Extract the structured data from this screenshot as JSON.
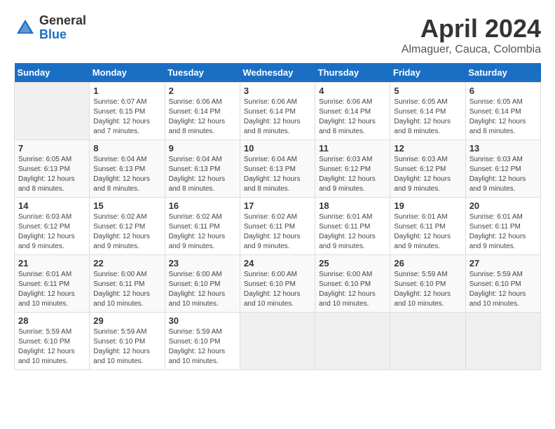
{
  "logo": {
    "general": "General",
    "blue": "Blue"
  },
  "title": {
    "month_year": "April 2024",
    "location": "Almaguer, Cauca, Colombia"
  },
  "days_of_week": [
    "Sunday",
    "Monday",
    "Tuesday",
    "Wednesday",
    "Thursday",
    "Friday",
    "Saturday"
  ],
  "weeks": [
    [
      {
        "day": "",
        "sunrise": "",
        "sunset": "",
        "daylight": ""
      },
      {
        "day": "1",
        "sunrise": "Sunrise: 6:07 AM",
        "sunset": "Sunset: 6:15 PM",
        "daylight": "Daylight: 12 hours and 7 minutes."
      },
      {
        "day": "2",
        "sunrise": "Sunrise: 6:06 AM",
        "sunset": "Sunset: 6:14 PM",
        "daylight": "Daylight: 12 hours and 8 minutes."
      },
      {
        "day": "3",
        "sunrise": "Sunrise: 6:06 AM",
        "sunset": "Sunset: 6:14 PM",
        "daylight": "Daylight: 12 hours and 8 minutes."
      },
      {
        "day": "4",
        "sunrise": "Sunrise: 6:06 AM",
        "sunset": "Sunset: 6:14 PM",
        "daylight": "Daylight: 12 hours and 8 minutes."
      },
      {
        "day": "5",
        "sunrise": "Sunrise: 6:05 AM",
        "sunset": "Sunset: 6:14 PM",
        "daylight": "Daylight: 12 hours and 8 minutes."
      },
      {
        "day": "6",
        "sunrise": "Sunrise: 6:05 AM",
        "sunset": "Sunset: 6:14 PM",
        "daylight": "Daylight: 12 hours and 8 minutes."
      }
    ],
    [
      {
        "day": "7",
        "sunrise": "Sunrise: 6:05 AM",
        "sunset": "Sunset: 6:13 PM",
        "daylight": "Daylight: 12 hours and 8 minutes."
      },
      {
        "day": "8",
        "sunrise": "Sunrise: 6:04 AM",
        "sunset": "Sunset: 6:13 PM",
        "daylight": "Daylight: 12 hours and 8 minutes."
      },
      {
        "day": "9",
        "sunrise": "Sunrise: 6:04 AM",
        "sunset": "Sunset: 6:13 PM",
        "daylight": "Daylight: 12 hours and 8 minutes."
      },
      {
        "day": "10",
        "sunrise": "Sunrise: 6:04 AM",
        "sunset": "Sunset: 6:13 PM",
        "daylight": "Daylight: 12 hours and 8 minutes."
      },
      {
        "day": "11",
        "sunrise": "Sunrise: 6:03 AM",
        "sunset": "Sunset: 6:12 PM",
        "daylight": "Daylight: 12 hours and 9 minutes."
      },
      {
        "day": "12",
        "sunrise": "Sunrise: 6:03 AM",
        "sunset": "Sunset: 6:12 PM",
        "daylight": "Daylight: 12 hours and 9 minutes."
      },
      {
        "day": "13",
        "sunrise": "Sunrise: 6:03 AM",
        "sunset": "Sunset: 6:12 PM",
        "daylight": "Daylight: 12 hours and 9 minutes."
      }
    ],
    [
      {
        "day": "14",
        "sunrise": "Sunrise: 6:03 AM",
        "sunset": "Sunset: 6:12 PM",
        "daylight": "Daylight: 12 hours and 9 minutes."
      },
      {
        "day": "15",
        "sunrise": "Sunrise: 6:02 AM",
        "sunset": "Sunset: 6:12 PM",
        "daylight": "Daylight: 12 hours and 9 minutes."
      },
      {
        "day": "16",
        "sunrise": "Sunrise: 6:02 AM",
        "sunset": "Sunset: 6:11 PM",
        "daylight": "Daylight: 12 hours and 9 minutes."
      },
      {
        "day": "17",
        "sunrise": "Sunrise: 6:02 AM",
        "sunset": "Sunset: 6:11 PM",
        "daylight": "Daylight: 12 hours and 9 minutes."
      },
      {
        "day": "18",
        "sunrise": "Sunrise: 6:01 AM",
        "sunset": "Sunset: 6:11 PM",
        "daylight": "Daylight: 12 hours and 9 minutes."
      },
      {
        "day": "19",
        "sunrise": "Sunrise: 6:01 AM",
        "sunset": "Sunset: 6:11 PM",
        "daylight": "Daylight: 12 hours and 9 minutes."
      },
      {
        "day": "20",
        "sunrise": "Sunrise: 6:01 AM",
        "sunset": "Sunset: 6:11 PM",
        "daylight": "Daylight: 12 hours and 9 minutes."
      }
    ],
    [
      {
        "day": "21",
        "sunrise": "Sunrise: 6:01 AM",
        "sunset": "Sunset: 6:11 PM",
        "daylight": "Daylight: 12 hours and 10 minutes."
      },
      {
        "day": "22",
        "sunrise": "Sunrise: 6:00 AM",
        "sunset": "Sunset: 6:11 PM",
        "daylight": "Daylight: 12 hours and 10 minutes."
      },
      {
        "day": "23",
        "sunrise": "Sunrise: 6:00 AM",
        "sunset": "Sunset: 6:10 PM",
        "daylight": "Daylight: 12 hours and 10 minutes."
      },
      {
        "day": "24",
        "sunrise": "Sunrise: 6:00 AM",
        "sunset": "Sunset: 6:10 PM",
        "daylight": "Daylight: 12 hours and 10 minutes."
      },
      {
        "day": "25",
        "sunrise": "Sunrise: 6:00 AM",
        "sunset": "Sunset: 6:10 PM",
        "daylight": "Daylight: 12 hours and 10 minutes."
      },
      {
        "day": "26",
        "sunrise": "Sunrise: 5:59 AM",
        "sunset": "Sunset: 6:10 PM",
        "daylight": "Daylight: 12 hours and 10 minutes."
      },
      {
        "day": "27",
        "sunrise": "Sunrise: 5:59 AM",
        "sunset": "Sunset: 6:10 PM",
        "daylight": "Daylight: 12 hours and 10 minutes."
      }
    ],
    [
      {
        "day": "28",
        "sunrise": "Sunrise: 5:59 AM",
        "sunset": "Sunset: 6:10 PM",
        "daylight": "Daylight: 12 hours and 10 minutes."
      },
      {
        "day": "29",
        "sunrise": "Sunrise: 5:59 AM",
        "sunset": "Sunset: 6:10 PM",
        "daylight": "Daylight: 12 hours and 10 minutes."
      },
      {
        "day": "30",
        "sunrise": "Sunrise: 5:59 AM",
        "sunset": "Sunset: 6:10 PM",
        "daylight": "Daylight: 12 hours and 10 minutes."
      },
      {
        "day": "",
        "sunrise": "",
        "sunset": "",
        "daylight": ""
      },
      {
        "day": "",
        "sunrise": "",
        "sunset": "",
        "daylight": ""
      },
      {
        "day": "",
        "sunrise": "",
        "sunset": "",
        "daylight": ""
      },
      {
        "day": "",
        "sunrise": "",
        "sunset": "",
        "daylight": ""
      }
    ]
  ]
}
